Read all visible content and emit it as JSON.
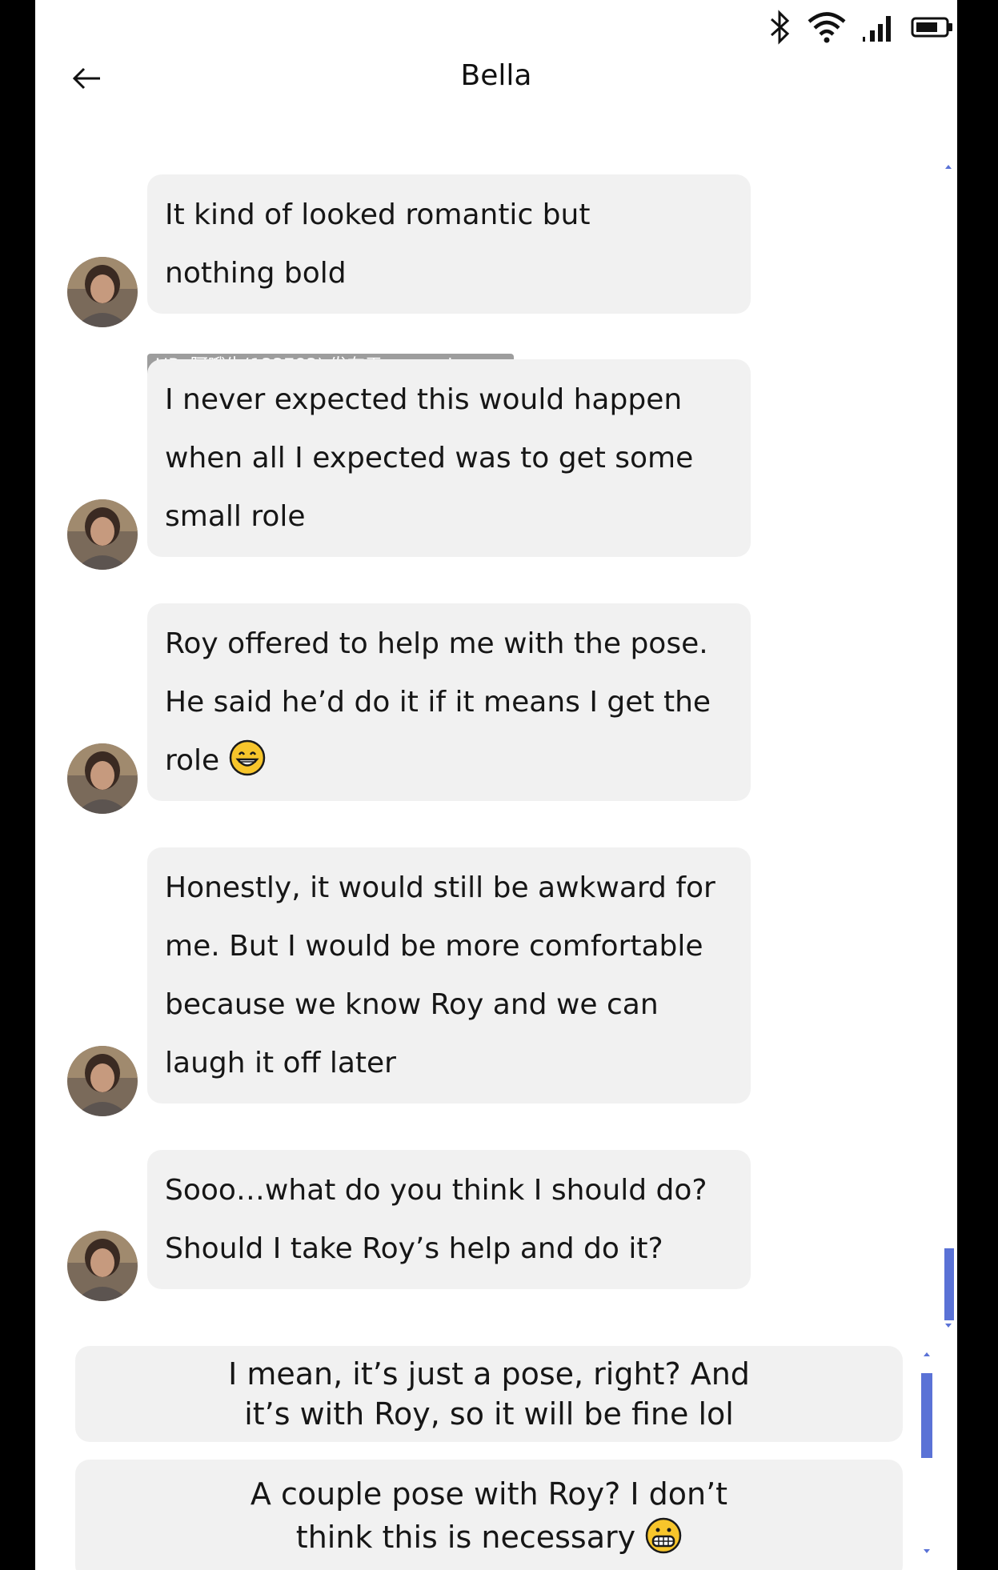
{
  "status_bar": {
    "icons": [
      "bluetooth-icon",
      "wifi-icon",
      "signal-icon",
      "battery-icon"
    ]
  },
  "header": {
    "back_icon": "arrow-left-icon",
    "title": "Bella"
  },
  "watermark": "UP: 阿哦牛(133783) 发布于 mengzhan.cc",
  "messages": [
    {
      "lines": [
        "It kind of looked romantic but",
        "nothing bold"
      ]
    },
    {
      "lines": [
        "I never expected this would happen",
        "when all I expected was to get some",
        "small role"
      ]
    },
    {
      "lines": [
        "Roy offered to help me with the pose.",
        "He said he’d do it if it means I get the",
        "role"
      ],
      "emoji": "grinning-face-emoji"
    },
    {
      "lines": [
        "Honestly, it would still be awkward for",
        "me. But I would be more comfortable",
        "because we know Roy and we can",
        "laugh it off later"
      ]
    },
    {
      "lines": [
        "Sooo…what do you think I should do?",
        "Should I take Roy’s help and do it?"
      ]
    }
  ],
  "choices": [
    {
      "lines": [
        "I mean, it’s just a pose, right? And",
        "it’s with Roy, so it will be fine lol"
      ]
    },
    {
      "lines": [
        "A couple pose with Roy? I don’t",
        "think this is necessary"
      ],
      "emoji": "grimacing-face-emoji"
    }
  ],
  "colors": {
    "bubble": "#f1f1f1",
    "scrollbar": "#5a72d6",
    "background": "#ffffff"
  }
}
